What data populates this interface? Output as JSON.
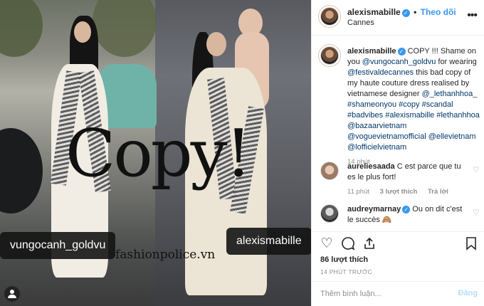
{
  "post_image": {
    "overlay_text": "Copy!",
    "tag_left": "vungocanh_goldvu",
    "tag_right": "alexismabille",
    "watermark": "fashionpolice.vn"
  },
  "header": {
    "username": "alexismabille",
    "separator": "•",
    "follow_label": "Theo dõi",
    "location": "Cannes",
    "more_icon": "more-horizontal-icon"
  },
  "caption": {
    "username": "alexismabille",
    "text_1": "COPY !!! Shame on you ",
    "mention_1": "@vungocanh_goldvu",
    "text_2": " for wearing ",
    "mention_2": "@festivaldecannes",
    "text_3": " this bad copy of my haute couture dress realised by vietnamese designer ",
    "mention_3": "@_lethanhhoa_",
    "hashtags": "#shameonyou #copy #scandal #badvibes #alexismabille #lethanhhoa",
    "mentions_tail": "@bazaarvietnam @voguevietnamofficial @ellevietnam @lofficielvietnam",
    "time": "14 phút"
  },
  "comments": [
    {
      "username": "aureliesaada",
      "text": "C est parce que tu es le plus fort!",
      "time": "11 phút",
      "likes": "3 lượt thích",
      "reply": "Trả lời"
    },
    {
      "username": "audreymarnay",
      "text": "Ou on dit c'est le succès 🙈"
    }
  ],
  "actions": {
    "likes": "86 lượt thích",
    "time_ago": "14 PHÚT TRƯỚC"
  },
  "add_comment": {
    "placeholder": "Thêm bình luận...",
    "post_label": "Đăng"
  }
}
